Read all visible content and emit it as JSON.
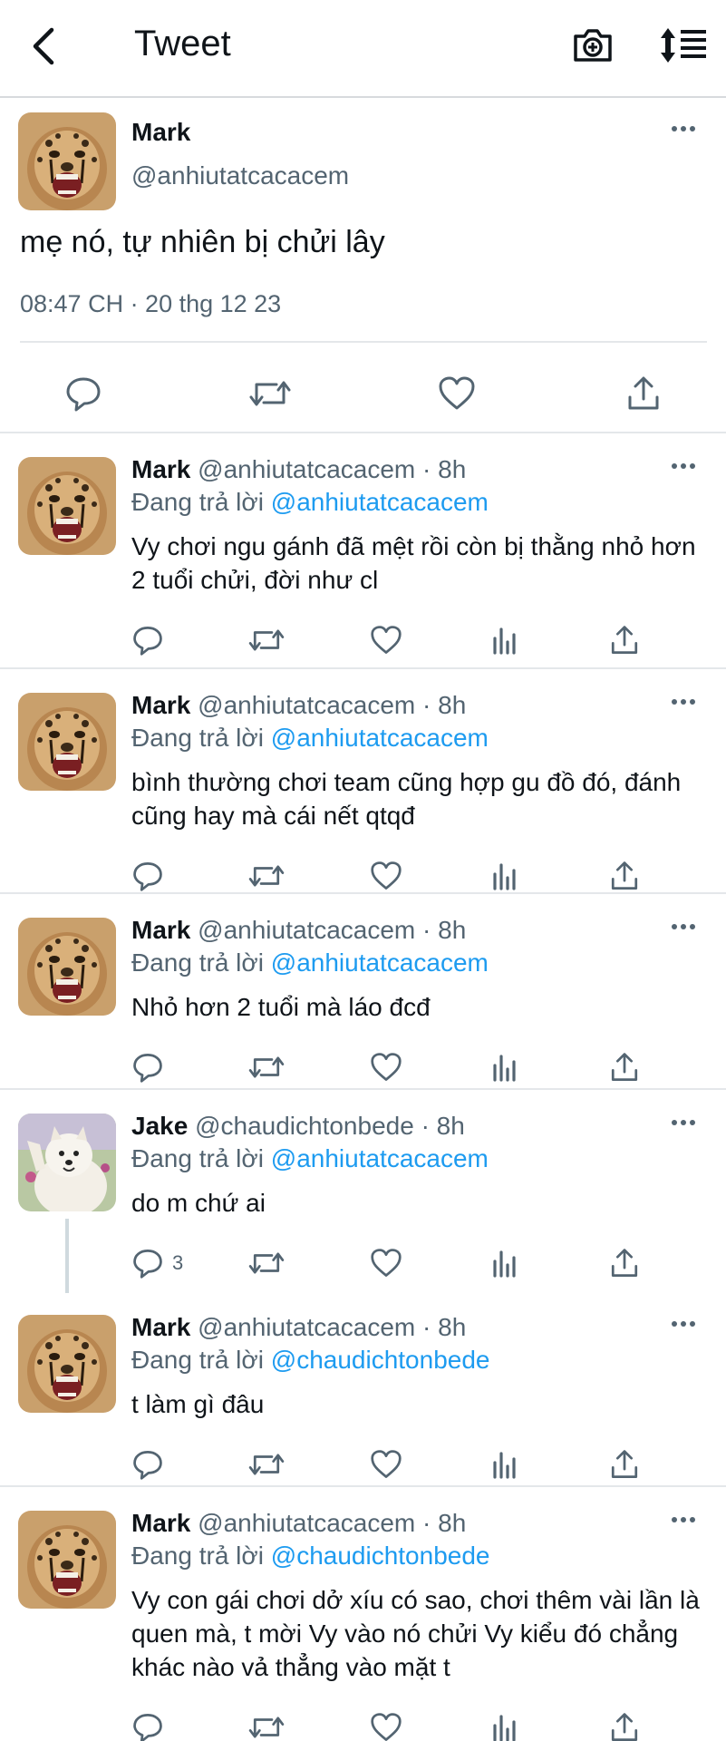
{
  "nav": {
    "title": "Tweet",
    "back_icon": "chevron-left-icon",
    "camera_icon": "camera-plus-icon",
    "sort_icon": "sort-icon"
  },
  "main_tweet": {
    "name": "Mark",
    "handle": "@anhiutatcacacem",
    "text": "mẹ nó, tự nhiên bị chửi lây",
    "meta": "08:47 CH · 20 thg 12 23"
  },
  "replies": [
    {
      "name": "Mark",
      "meta": " @anhiutatcacacem · 8h",
      "reply_label": "Đang trả lời ",
      "mention": "@anhiutatcacacem",
      "text": "Vy chơi ngu gánh đã mệt rồi còn bị thằng nhỏ hơn 2 tuổi chửi, đời như cl",
      "reply_count": ""
    },
    {
      "name": "Mark",
      "meta": " @anhiutatcacacem · 8h",
      "reply_label": "Đang trả lời ",
      "mention": "@anhiutatcacacem",
      "text": "bình thường chơi team cũng hợp gu đồ đó, đánh cũng hay mà cái nết qtqđ",
      "reply_count": ""
    },
    {
      "name": "Mark",
      "meta": " @anhiutatcacacem · 8h",
      "reply_label": "Đang trả lời ",
      "mention": "@anhiutatcacacem",
      "text": "Nhỏ hơn 2 tuổi mà láo đcđ",
      "reply_count": ""
    },
    {
      "name": "Jake",
      "meta": " @chaudichtonbede · 8h",
      "reply_label": "Đang trả lời ",
      "mention": "@anhiutatcacacem",
      "text": "do m chứ ai",
      "reply_count": "3"
    },
    {
      "name": "Mark",
      "meta": " @anhiutatcacacem · 8h",
      "reply_label": "Đang trả lời ",
      "mention": "@chaudichtonbede",
      "text": "t làm gì đâu",
      "reply_count": ""
    },
    {
      "name": "Mark",
      "meta": " @anhiutatcacacem · 8h",
      "reply_label": "Đang trả lời ",
      "mention": "@chaudichtonbede",
      "text": "Vy con gái chơi dở xíu có sao, chơi thêm vài lần là quen mà, t mời Vy vào nó chửi Vy kiểu đó chẳng khác nào vả thẳng vào mặt t",
      "reply_count": ""
    }
  ],
  "colors": {
    "text": "#0f1419",
    "secondary": "#536471",
    "link": "#1d9bf0",
    "divider": "#e4e7ea"
  }
}
